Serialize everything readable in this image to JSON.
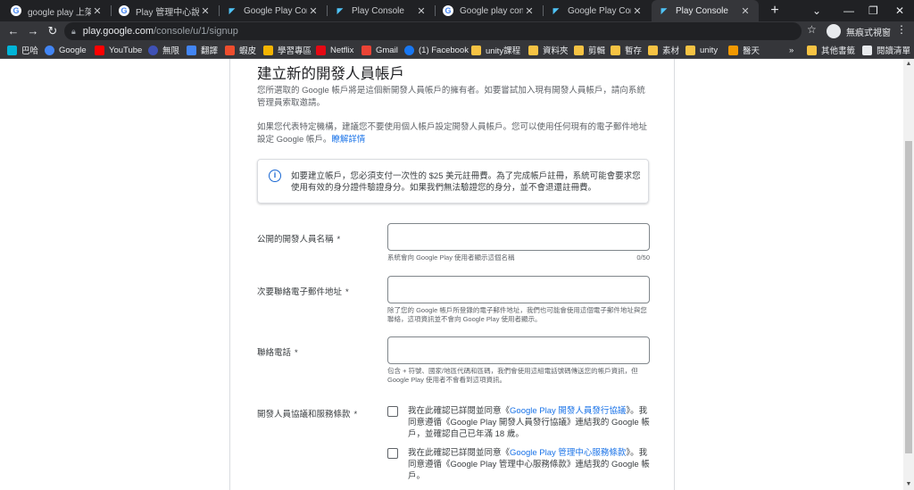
{
  "tabs": [
    {
      "title": "google play 上架 - G",
      "icon": "google-icon",
      "active": false
    },
    {
      "title": "Play 管理中心說明",
      "icon": "google-icon",
      "active": false
    },
    {
      "title": "Google Play Console",
      "icon": "play-console-icon",
      "active": false
    },
    {
      "title": "Play Console",
      "icon": "play-console-icon",
      "active": false
    },
    {
      "title": "Google play console",
      "icon": "google-icon",
      "active": false
    },
    {
      "title": "Google Play Console",
      "icon": "play-console-icon",
      "active": false
    },
    {
      "title": "Play Console",
      "icon": "play-console-icon",
      "active": true
    }
  ],
  "omnibox": {
    "domain": "play.google.com",
    "path": "/console/u/1/signup"
  },
  "profile": {
    "label": "無痕式視窗"
  },
  "bookmarks": [
    {
      "label": "巴哈",
      "color": "#00b4d8"
    },
    {
      "label": "Google",
      "color": "#4285f4"
    },
    {
      "label": "YouTube",
      "color": "#ff0000"
    },
    {
      "label": "無限",
      "color": "#3f51b5"
    },
    {
      "label": "翻譯",
      "color": "#4285f4"
    },
    {
      "label": "蝦皮",
      "color": "#ee4d2d"
    },
    {
      "label": "學習專區",
      "color": "#f4b400"
    },
    {
      "label": "Netflix",
      "color": "#e50914"
    },
    {
      "label": "Gmail",
      "color": "#ea4335"
    },
    {
      "label": "(1) Facebook",
      "color": "#1877f2"
    },
    {
      "label": "unity課程",
      "color": "#f6c343"
    },
    {
      "label": "資料夾",
      "color": "#f6c343"
    },
    {
      "label": "剪輯",
      "color": "#f6c343"
    },
    {
      "label": "暫存",
      "color": "#f6c343"
    },
    {
      "label": "素材",
      "color": "#f6c343"
    },
    {
      "label": "unity",
      "color": "#f6c343"
    },
    {
      "label": "醫天",
      "color": "#f29900"
    }
  ],
  "bookmarks_right": {
    "overflow": "»",
    "other": "其他書籤",
    "reading": "閱讀清單"
  },
  "form": {
    "title": "建立新的開發人員帳戶",
    "intro": "您所選取的 Google 帳戶將是這個新開發人員帳戶的擁有者。如要嘗試加入現有開發人員帳戶，請向系統管理員索取邀請。",
    "org_note": "如果您代表特定機構，建議您不要使用個人帳戶設定開發人員帳戶。您可以使用任何現有的電子郵件地址設定 Google 帳戶。",
    "learn_more": "瞭解詳情",
    "info": "如要建立帳戶，您必須支付一次性的 $25 美元註冊費。為了完成帳戶註冊，系統可能會要求您使用有效的身分證件驗證身分。如果我們無法驗證您的身分，並不會退還註冊費。",
    "fields": {
      "name": {
        "label": "公開的開發人員名稱",
        "required": "*",
        "value": "",
        "hint": "系統會向 Google Play 使用者顯示這個名稱",
        "counter": "0/50"
      },
      "email": {
        "label": "次要聯絡電子郵件地址",
        "required": "*",
        "value": "",
        "hint": "除了您的 Google 帳戶所登錄的電子郵件地址，我們也可能會使用這個電子郵件地址與您聯絡，這項資訊並不會向 Google Play 使用者顯示。"
      },
      "phone": {
        "label": "聯絡電話",
        "required": "*",
        "value": "",
        "hint": "包含 + 符號、國家/地區代碼和區碼，我們會使用這組電話號碼傳送您的帳戶資訊，但 Google Play 使用者不會看到這項資訊。"
      }
    },
    "terms": {
      "label": "開發人員協議和服務條款",
      "required": "*",
      "cb1_pre": "我在此確認已詳閱並同意《",
      "cb1_link": "Google Play 開發人員發行協議",
      "cb1_post": "》。我同意遵循《Google Play 開發人員發行協議》連結我的 Google 帳戶，並確認自己已年滿 18 歲。",
      "cb2_pre": "我在此確認已詳閱並同意《",
      "cb2_link": "Google Play 管理中心服務條款",
      "cb2_post": "》。我同意遵循《Google Play 管理中心服務條款》連結我的 Google 帳戶。"
    }
  }
}
